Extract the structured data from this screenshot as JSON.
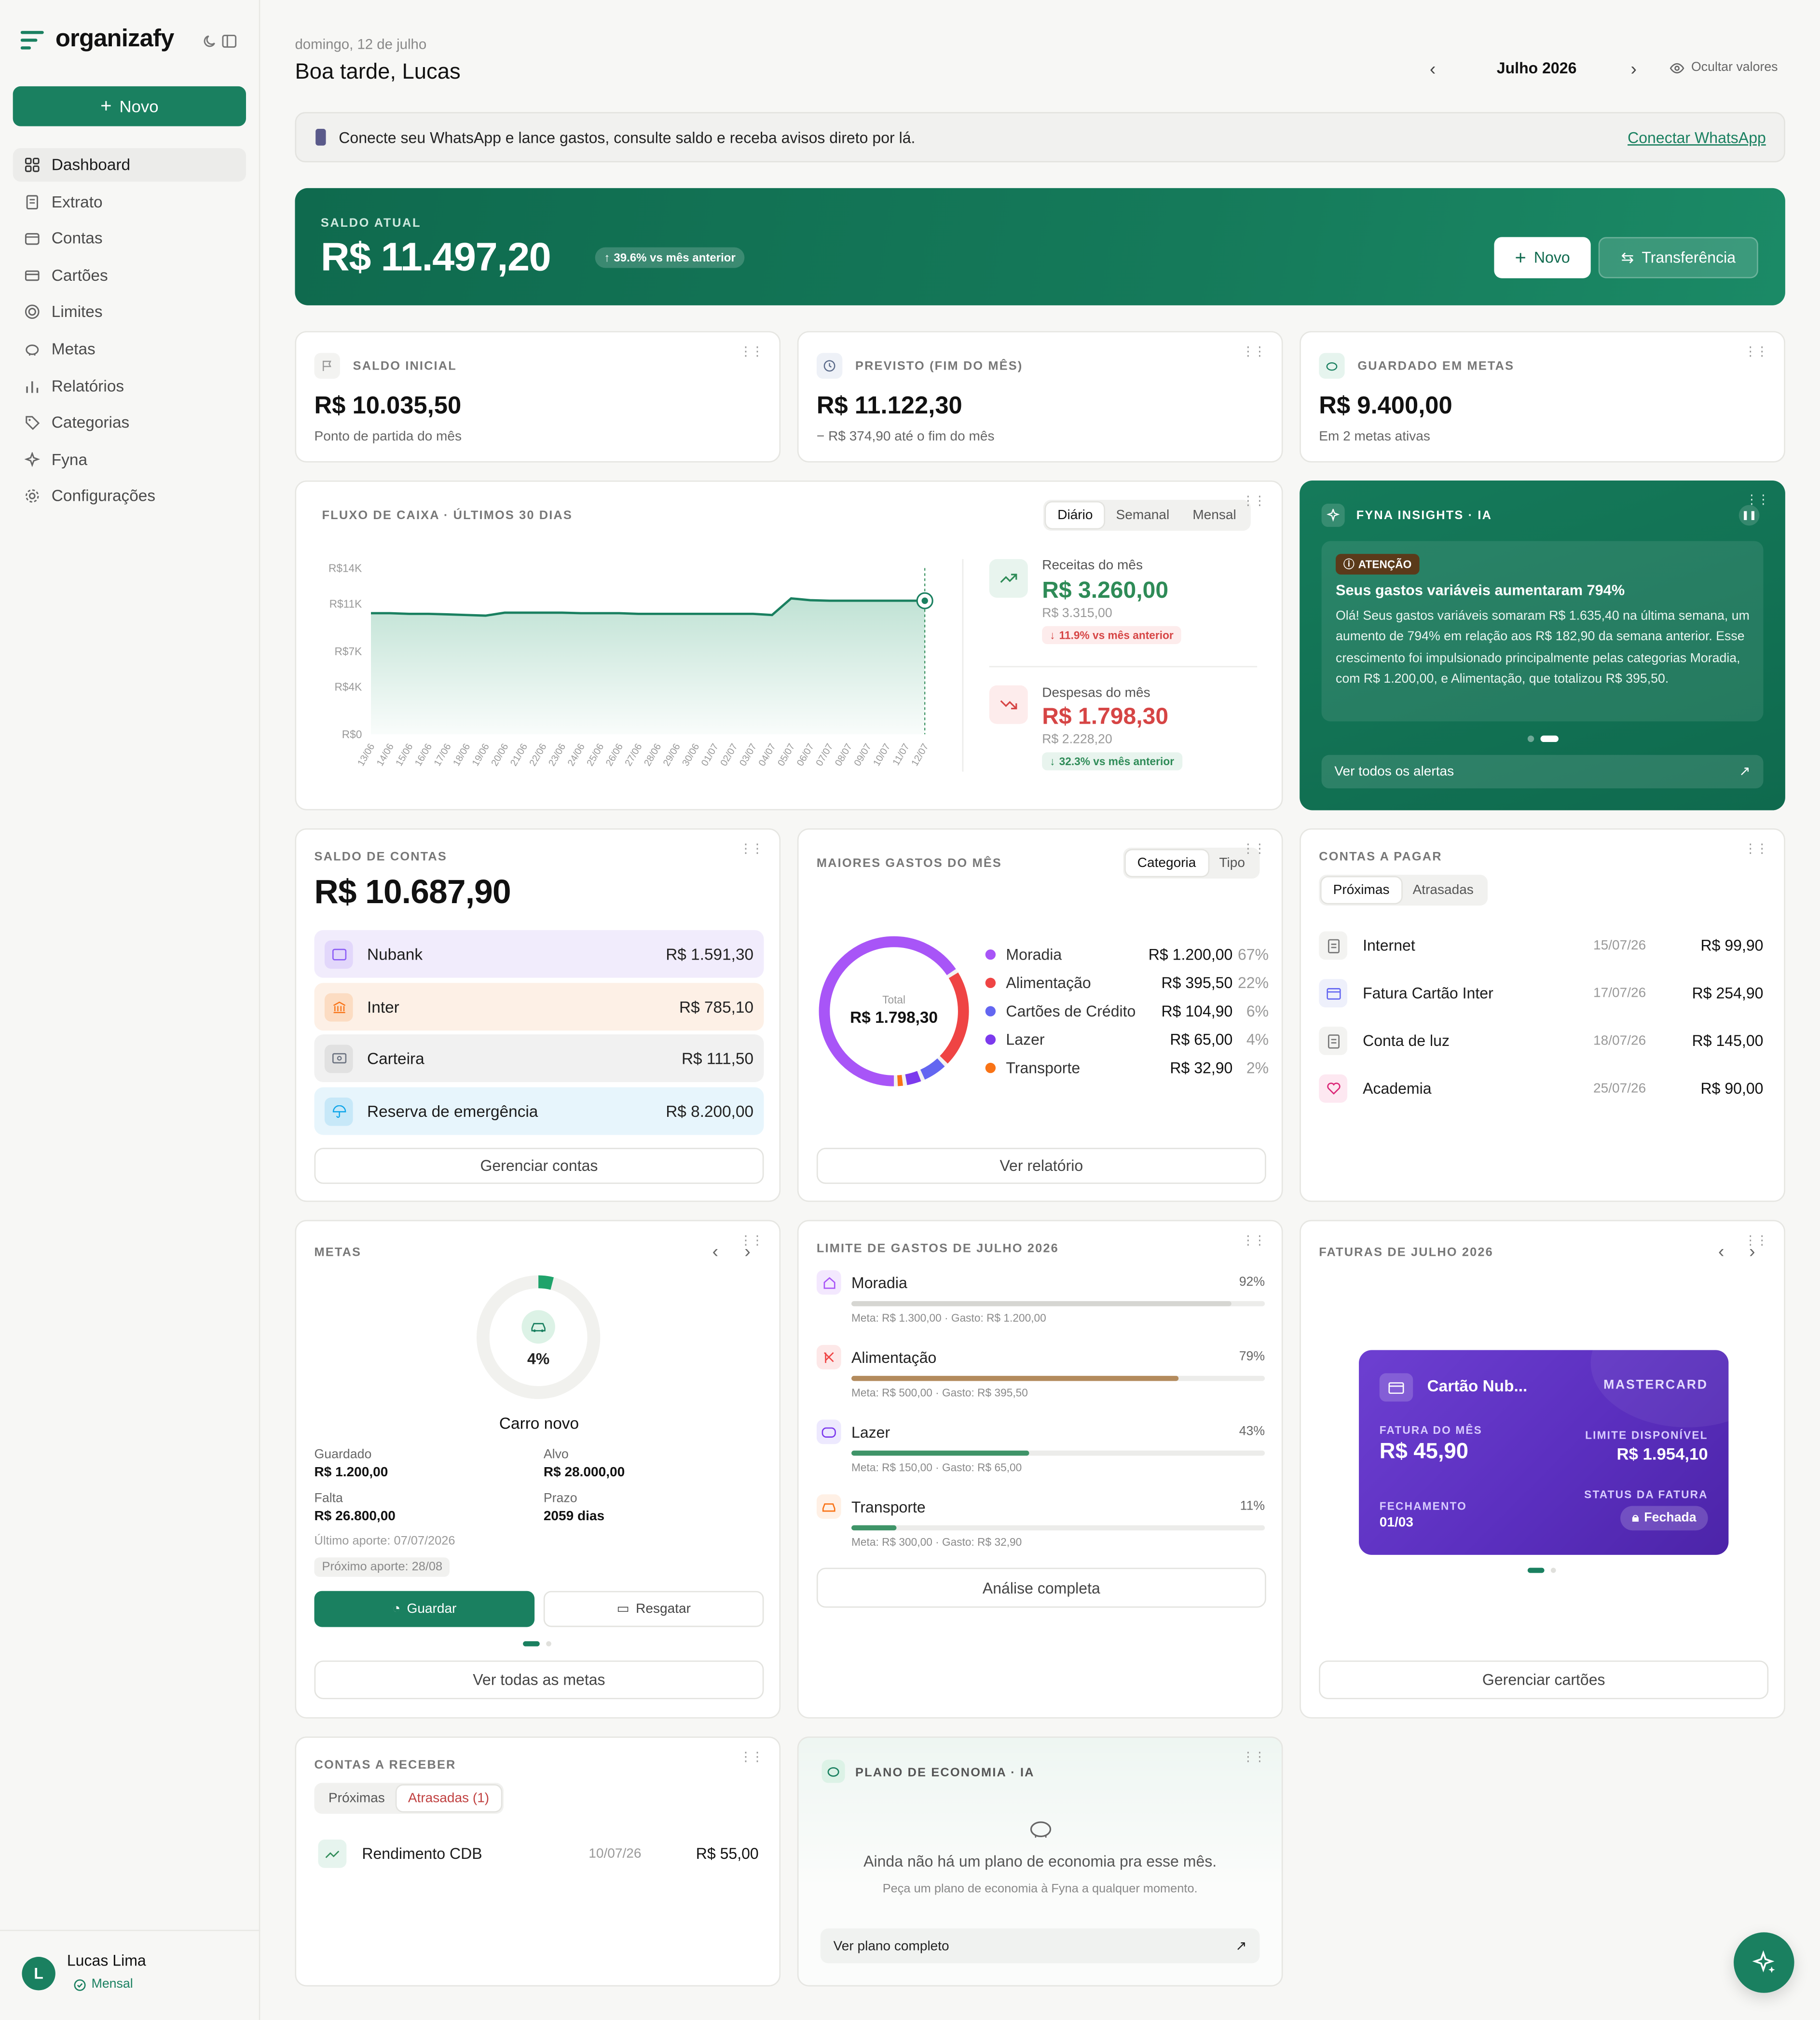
{
  "brand": {
    "name": "organizafy"
  },
  "sidebar": {
    "new_label": "Novo",
    "items": [
      {
        "label": "Dashboard",
        "icon": "grid-icon"
      },
      {
        "label": "Extrato",
        "icon": "receipt-icon"
      },
      {
        "label": "Contas",
        "icon": "wallet-icon"
      },
      {
        "label": "Cartões",
        "icon": "card-icon"
      },
      {
        "label": "Limites",
        "icon": "target-icon"
      },
      {
        "label": "Metas",
        "icon": "piggy-icon"
      },
      {
        "label": "Relatórios",
        "icon": "bars-icon"
      },
      {
        "label": "Categorias",
        "icon": "tag-icon"
      },
      {
        "label": "Fyna",
        "icon": "sparkle-icon"
      },
      {
        "label": "Configurações",
        "icon": "gear-icon"
      }
    ],
    "user": {
      "initial": "L",
      "name": "Lucas Lima",
      "plan": "Mensal"
    }
  },
  "header": {
    "date": "domingo, 12 de julho",
    "greeting": "Boa tarde, Lucas",
    "month": "Julho 2026",
    "hide_values": "Ocultar valores"
  },
  "whatsapp": {
    "text": "Conecte seu WhatsApp e lance gastos, consulte saldo e receba avisos direto por lá.",
    "link": "Conectar WhatsApp"
  },
  "balance": {
    "caption": "SALDO ATUAL",
    "value": "R$ 11.497,20",
    "badge": "39.6% vs mês anterior",
    "new_label": "Novo",
    "transfer_label": "Transferência"
  },
  "stats": [
    {
      "caption": "SALDO INICIAL",
      "value": "R$ 10.035,50",
      "sub": "Ponto de partida do mês"
    },
    {
      "caption": "PREVISTO (FIM DO MÊS)",
      "value": "R$ 11.122,30",
      "sub": "− R$ 374,90 até o fim do mês"
    },
    {
      "caption": "GUARDADO EM METAS",
      "value": "R$ 9.400,00",
      "sub": "Em 2 metas ativas"
    }
  ],
  "cashflow": {
    "caption": "FLUXO DE CAIXA · ÚLTIMOS 30 DIAS",
    "tabs": [
      "Diário",
      "Semanal",
      "Mensal"
    ],
    "income": {
      "label": "Receitas do mês",
      "value": "R$ 3.260,00",
      "prev": "R$ 3.315,00",
      "delta": "11.9% vs mês anterior"
    },
    "expense": {
      "label": "Despesas do mês",
      "value": "R$ 1.798,30",
      "prev": "R$ 2.228,20",
      "delta": "32.3% vs mês anterior"
    }
  },
  "chart_data": {
    "type": "area",
    "title": "FLUXO DE CAIXA · ÚLTIMOS 30 DIAS",
    "x": [
      "13/06",
      "14/06",
      "15/06",
      "16/06",
      "17/06",
      "18/06",
      "19/06",
      "20/06",
      "21/06",
      "22/06",
      "23/06",
      "24/06",
      "25/06",
      "26/06",
      "27/06",
      "28/06",
      "29/06",
      "30/06",
      "01/07",
      "02/07",
      "03/07",
      "04/07",
      "05/07",
      "06/07",
      "07/07",
      "08/07",
      "09/07",
      "10/07",
      "11/07",
      "12/07"
    ],
    "y": [
      10200,
      10200,
      10150,
      10150,
      10100,
      10050,
      10000,
      10250,
      10250,
      10250,
      10250,
      10200,
      10200,
      10200,
      10150,
      10150,
      10150,
      10150,
      10150,
      10150,
      10150,
      10050,
      11450,
      11300,
      11250,
      11250,
      11250,
      11250,
      11250,
      11250
    ],
    "yticks": [
      "R$0",
      "R$4K",
      "R$7K",
      "R$11K",
      "R$14K"
    ],
    "ylim": [
      0,
      14000
    ]
  },
  "insights": {
    "caption": "FYNA INSIGHTS · IA",
    "tag": "ATENÇÃO",
    "title": "Seus gastos variáveis aumentaram 794%",
    "body": "Olá! Seus gastos variáveis somaram R$ 1.635,40 na última semana, um aumento de 794% em relação aos R$ 182,90 da semana anterior. Esse crescimento foi impulsionado principalmente pelas categorias Moradia, com R$ 1.200,00, e Alimentação, que totalizou R$ 395,50.",
    "link": "Ver todos os alertas"
  },
  "accounts": {
    "caption": "SALDO DE CONTAS",
    "total": "R$ 10.687,90",
    "items": [
      {
        "name": "Nubank",
        "value": "R$ 1.591,30",
        "color": "#8b5cf6"
      },
      {
        "name": "Inter",
        "value": "R$ 785,10",
        "color": "#f97316"
      },
      {
        "name": "Carteira",
        "value": "R$ 111,50",
        "color": "#6b7280"
      },
      {
        "name": "Reserva de emergência",
        "value": "R$ 8.200,00",
        "color": "#0ea5e9"
      }
    ],
    "button": "Gerenciar contas"
  },
  "spending": {
    "caption": "MAIORES GASTOS DO MÊS",
    "tabs": [
      "Categoria",
      "Tipo"
    ],
    "total_label": "Total",
    "total": "R$ 1.798,30",
    "items": [
      {
        "name": "Moradia",
        "value": "R$ 1.200,00",
        "pct": "67%",
        "share": 67,
        "color": "#a855f7"
      },
      {
        "name": "Alimentação",
        "value": "R$ 395,50",
        "pct": "22%",
        "share": 22,
        "color": "#ef4444"
      },
      {
        "name": "Cartões de Crédito",
        "value": "R$ 104,90",
        "pct": "6%",
        "share": 6,
        "color": "#6366f1"
      },
      {
        "name": "Lazer",
        "value": "R$ 65,00",
        "pct": "4%",
        "share": 4,
        "color": "#7c3aed"
      },
      {
        "name": "Transporte",
        "value": "R$ 32,90",
        "pct": "2%",
        "share": 2,
        "color": "#f97316"
      }
    ],
    "button": "Ver relatório"
  },
  "payables": {
    "caption": "CONTAS A PAGAR",
    "tabs": [
      "Próximas",
      "Atrasadas"
    ],
    "items": [
      {
        "name": "Internet",
        "date": "15/07/26",
        "value": "R$ 99,90",
        "icon": "receipt-icon"
      },
      {
        "name": "Fatura Cartão Inter",
        "date": "17/07/26",
        "value": "R$ 254,90",
        "icon": "card-icon"
      },
      {
        "name": "Conta de luz",
        "date": "18/07/26",
        "value": "R$ 145,00",
        "icon": "receipt-icon"
      },
      {
        "name": "Academia",
        "date": "25/07/26",
        "value": "R$ 90,00",
        "icon": "heart-icon"
      }
    ]
  },
  "goals": {
    "caption": "METAS",
    "percent": "4%",
    "progress": 0.04,
    "name": "Carro novo",
    "saved_label": "Guardado",
    "saved": "R$ 1.200,00",
    "target_label": "Alvo",
    "target": "R$ 28.000,00",
    "missing_label": "Falta",
    "missing": "R$ 26.800,00",
    "deadline_label": "Prazo",
    "deadline": "2059 dias",
    "last": "Último aporte: 07/07/2026",
    "next": "Próximo aporte: 28/08",
    "save_btn": "Guardar",
    "withdraw_btn": "Resgatar",
    "all_btn": "Ver todas as metas"
  },
  "limits": {
    "caption": "LIMITE DE GASTOS DE JULHO 2026",
    "items": [
      {
        "name": "Moradia",
        "pct": "92%",
        "level": 0.92,
        "sub": "Meta: R$ 1.300,00 · Gasto: R$ 1.200,00",
        "color": "#d6d6d2",
        "icon_color": "#a855f7"
      },
      {
        "name": "Alimentação",
        "pct": "79%",
        "level": 0.79,
        "sub": "Meta: R$ 500,00 · Gasto: R$ 395,50",
        "color": "#b38b5d",
        "icon_color": "#ef4444"
      },
      {
        "name": "Lazer",
        "pct": "43%",
        "level": 0.43,
        "sub": "Meta: R$ 150,00 · Gasto: R$ 65,00",
        "color": "#3f9468",
        "icon_color": "#7c3aed"
      },
      {
        "name": "Transporte",
        "pct": "11%",
        "level": 0.11,
        "sub": "Meta: R$ 300,00 · Gasto: R$ 32,90",
        "color": "#3f9468",
        "icon_color": "#f97316"
      }
    ],
    "button": "Análise completa"
  },
  "invoices": {
    "caption": "FATURAS DE JULHO 2026",
    "card": {
      "name": "Cartão Nub...",
      "brand": "MASTERCARD",
      "bill_label": "FATURA DO MÊS",
      "bill": "R$ 45,90",
      "limit_label": "LIMITE DISPONÍVEL",
      "limit": "R$ 1.954,10",
      "close_label": "FECHAMENTO",
      "close": "01/03",
      "status_label": "STATUS DA FATURA",
      "status": "Fechada"
    },
    "button": "Gerenciar cartões"
  },
  "receivables": {
    "caption": "CONTAS A RECEBER",
    "tabs": [
      "Próximas",
      "Atrasadas (1)"
    ],
    "items": [
      {
        "name": "Rendimento CDB",
        "date": "10/07/26",
        "value": "R$ 55,00"
      }
    ]
  },
  "plan": {
    "caption": "PLANO DE ECONOMIA · IA",
    "empty": "Ainda não há um plano de economia pra esse mês.",
    "hint": "Peça um plano de economia à Fyna a qualquer momento.",
    "link": "Ver plano completo"
  },
  "colors": {
    "primary": "#1a8060",
    "income": "#2e8b57",
    "expense": "#d64545"
  }
}
